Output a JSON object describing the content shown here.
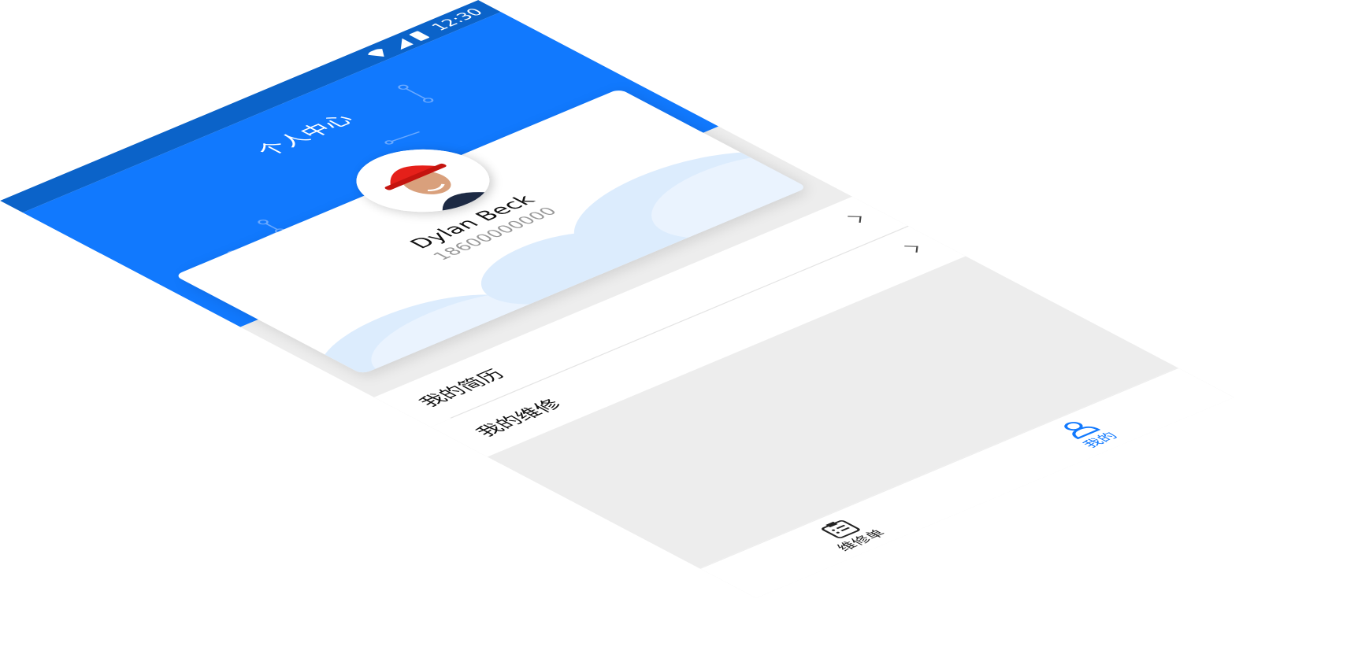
{
  "status_bar": {
    "time": "12:30",
    "icons": [
      "wifi-icon",
      "signal-icon",
      "battery-icon"
    ]
  },
  "header": {
    "title": "个人中心"
  },
  "profile": {
    "name": "Dylan Beck",
    "phone": "18600000000"
  },
  "menu": [
    {
      "label": "我的简历",
      "icon": "chevron-right-icon"
    },
    {
      "label": "我的维修",
      "icon": "chevron-right-icon"
    }
  ],
  "tabbar": {
    "items": [
      {
        "label": "维修单",
        "icon": "clipboard-icon",
        "active": false
      },
      {
        "label": "我的",
        "icon": "user-icon",
        "active": true
      }
    ]
  },
  "colors": {
    "primary": "#1179fe",
    "status_bar": "#0b63c9",
    "background": "#ededed"
  }
}
